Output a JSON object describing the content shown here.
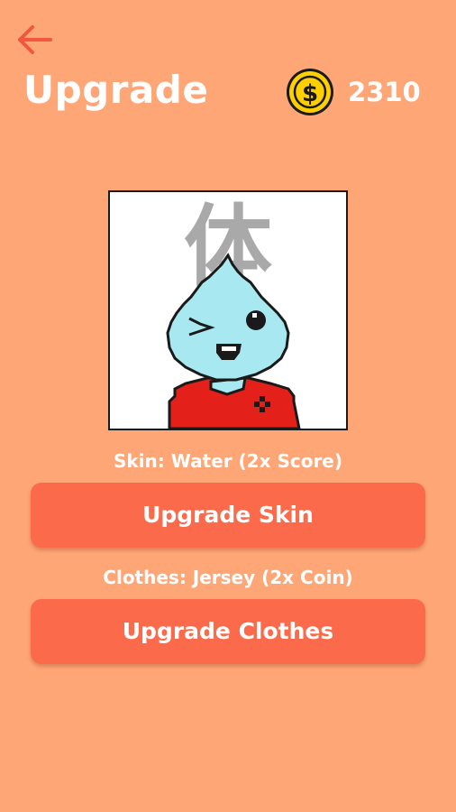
{
  "header": {
    "back_icon": "arrow-left-icon",
    "title": "Upgrade",
    "coin_icon": "dollar-coin-icon",
    "coins": "2310"
  },
  "avatar": {
    "kanji": "体",
    "skin_color": "#A8E8F0",
    "shirt_color": "#E4201B"
  },
  "skin": {
    "label": "Skin: Water (2x Score)",
    "button_label": "Upgrade Skin"
  },
  "clothes": {
    "label": "Clothes: Jersey (2x Coin)",
    "button_label": "Upgrade Clothes"
  },
  "colors": {
    "background": "#FFA676",
    "button": "#FB6A4A",
    "back_arrow": "#F0583C",
    "coin": "#FFD000"
  }
}
